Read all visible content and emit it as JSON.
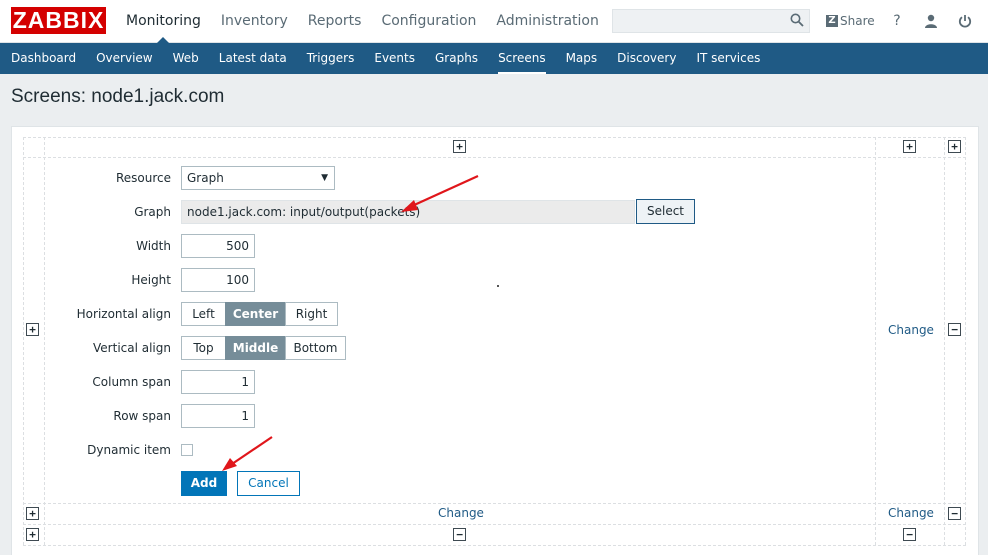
{
  "header": {
    "logo": "ZABBIX",
    "menu": [
      "Monitoring",
      "Inventory",
      "Reports",
      "Configuration",
      "Administration"
    ],
    "search_placeholder": "",
    "share_label": "Share",
    "help_icon": "?"
  },
  "submenu": [
    "Dashboard",
    "Overview",
    "Web",
    "Latest data",
    "Triggers",
    "Events",
    "Graphs",
    "Screens",
    "Maps",
    "Discovery",
    "IT services"
  ],
  "page_title": "Screens: node1.jack.com",
  "form": {
    "resource_label": "Resource",
    "resource_value": "Graph",
    "graph_label": "Graph",
    "graph_value": "node1.jack.com: input/output(packets)",
    "select_button": "Select",
    "width_label": "Width",
    "width_value": "500",
    "height_label": "Height",
    "height_value": "100",
    "halign_label": "Horizontal align",
    "halign_options": [
      "Left",
      "Center",
      "Right"
    ],
    "halign_selected": "Center",
    "valign_label": "Vertical align",
    "valign_options": [
      "Top",
      "Middle",
      "Bottom"
    ],
    "valign_selected": "Middle",
    "colspan_label": "Column span",
    "colspan_value": "1",
    "rowspan_label": "Row span",
    "rowspan_value": "1",
    "dynamic_label": "Dynamic item",
    "dynamic_checked": false,
    "add_button": "Add",
    "cancel_button": "Cancel"
  },
  "grid": {
    "plus": "+",
    "minus": "−",
    "change": "Change"
  },
  "colors": {
    "brand": "#d40000",
    "nav": "#1f5a85",
    "primary": "#0275b8",
    "arrow": "#e0161b"
  },
  "icons": [
    "search-icon",
    "share-icon",
    "help-icon",
    "user-icon",
    "power-icon",
    "dropdown-arrow-icon",
    "plus-icon",
    "minus-icon",
    "annotation-arrow-icon"
  ]
}
